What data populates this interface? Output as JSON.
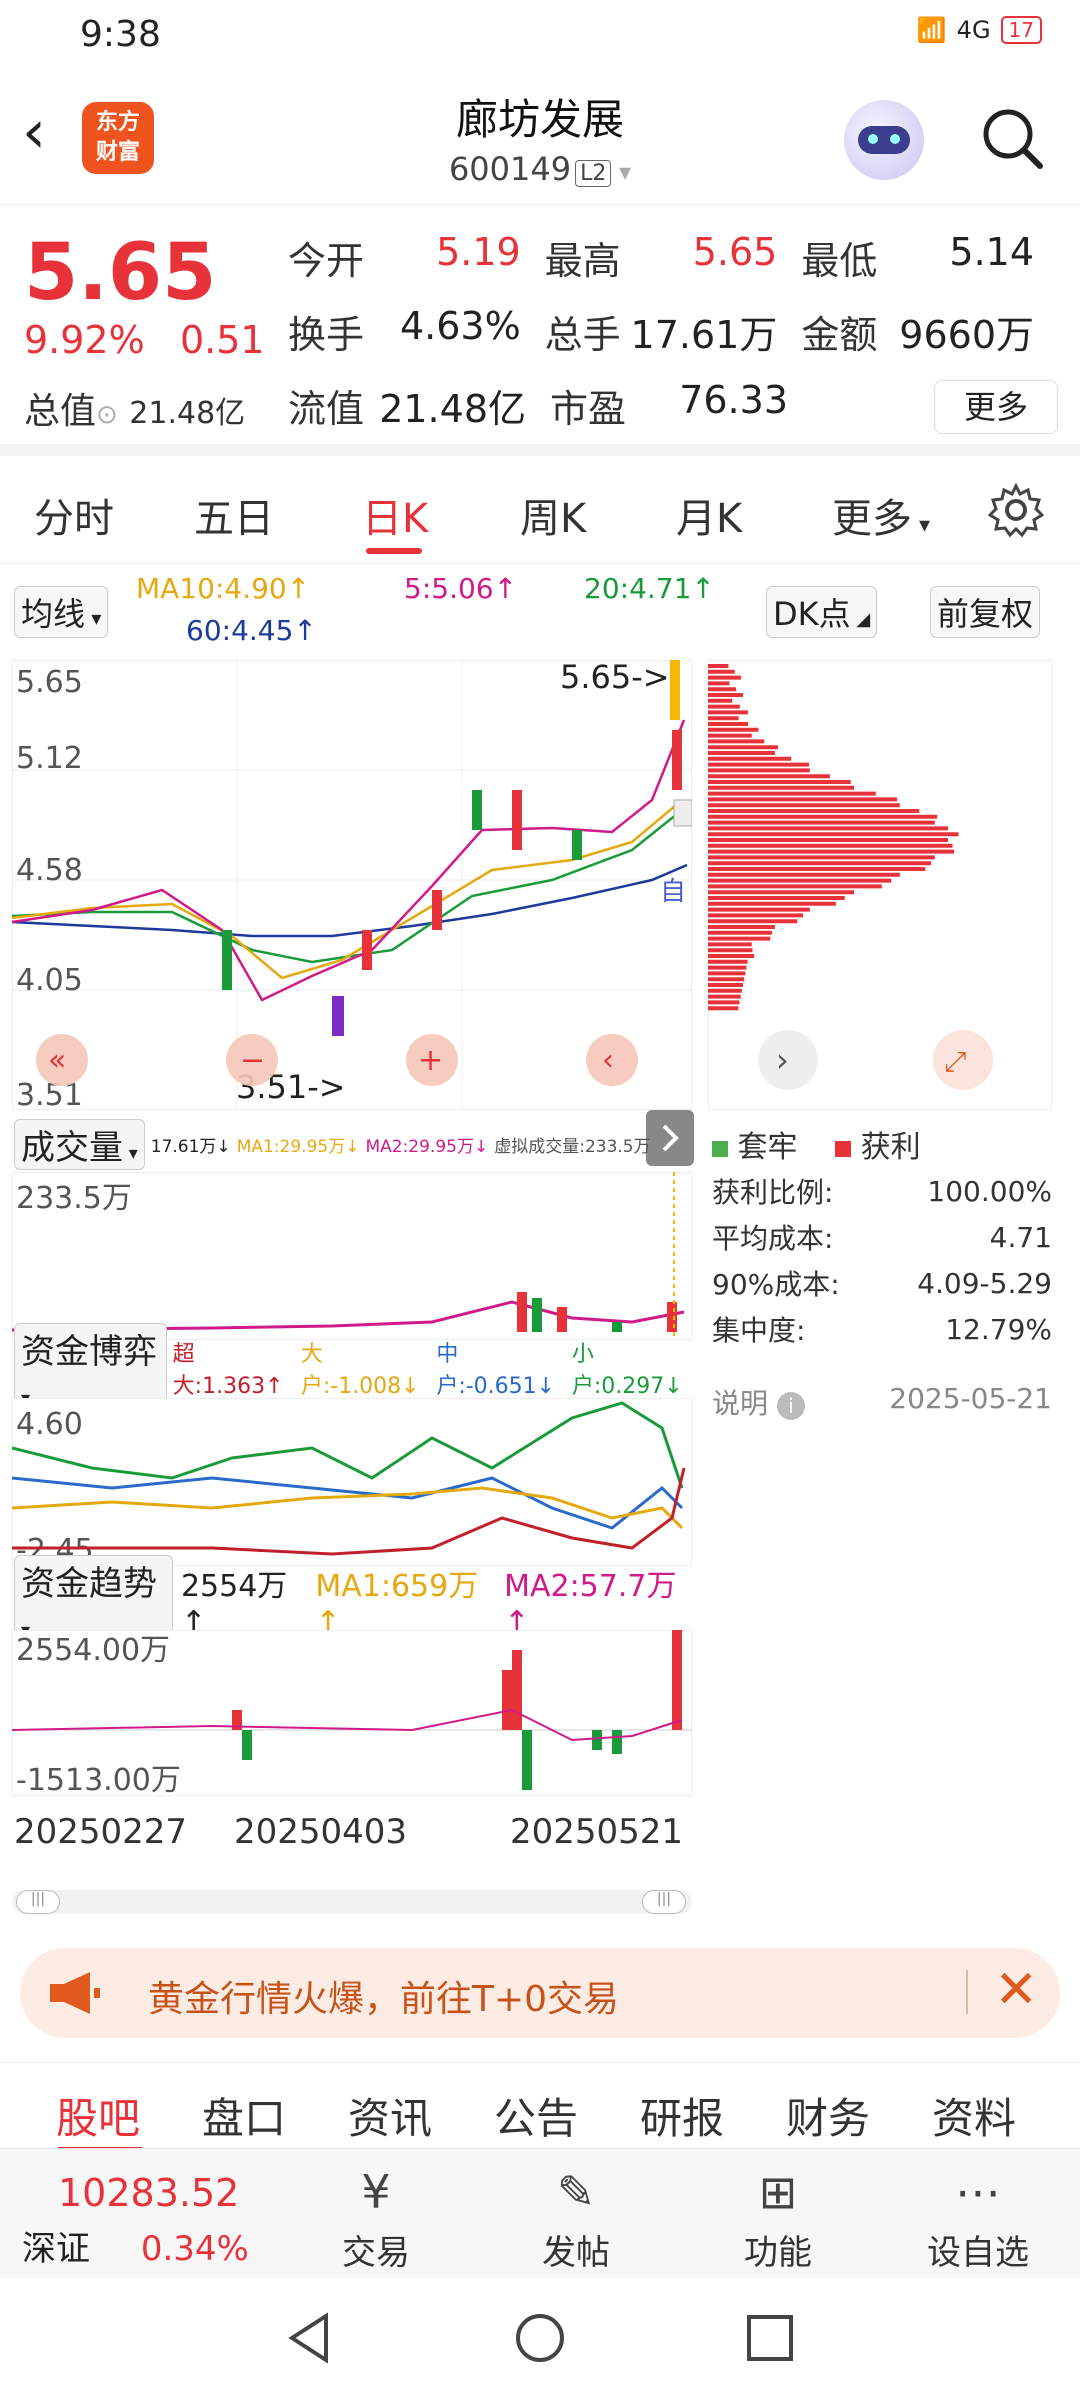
{
  "status": {
    "time": "9:38",
    "network": "4G",
    "battery": "17"
  },
  "header": {
    "title": "廊坊发展",
    "code": "600149",
    "level": "L2",
    "logo_line1": "东方",
    "logo_line2": "财富"
  },
  "quote": {
    "price": "5.65",
    "pct": "9.92%",
    "change": "0.51",
    "total_value_label": "总值",
    "total_value": "21.48亿",
    "rows": [
      [
        {
          "label": "今开",
          "value": "5.19",
          "color": "red"
        },
        {
          "label": "最高",
          "value": "5.65",
          "color": "red"
        },
        {
          "label": "最低",
          "value": "5.14",
          "color": "normal"
        }
      ],
      [
        {
          "label": "换手",
          "value": "4.63%",
          "color": "normal"
        },
        {
          "label": "总手",
          "value": "17.61万",
          "color": "normal"
        },
        {
          "label": "金额",
          "value": "9660万",
          "color": "normal"
        }
      ],
      [
        {
          "label": "流值",
          "value": "21.48亿",
          "color": "normal"
        },
        {
          "label": "市盈",
          "value": "76.33",
          "color": "normal"
        }
      ]
    ],
    "more": "更多"
  },
  "tabs": [
    "分时",
    "五日",
    "日K",
    "周K",
    "月K",
    "更多"
  ],
  "active_tab": "日K",
  "ma": {
    "selector": "均线",
    "ma10": "MA10:4.90↑",
    "ma5": "5:5.06↑",
    "ma20": "20:4.71↑",
    "ma60": "60:4.45↑",
    "dk": "DK点",
    "fq": "前复权"
  },
  "kchart": {
    "y_labels": [
      "5.65",
      "5.12",
      "4.58",
      "4.05",
      "3.51"
    ],
    "high_marker": "5.65->",
    "low_marker": "3.51->",
    "self_tag": "自"
  },
  "volume": {
    "selector": "成交量",
    "info": "17.61万↓",
    "ma1": "MA1:29.95万↓",
    "ma2": "MA2:29.95万↓",
    "virtual": "虚拟成交量:233.5万",
    "max_label": "233.5万"
  },
  "fund_game": {
    "selector": "资金博弈",
    "super": "超大:1.363↑",
    "large": "大户:-1.008↓",
    "mid": "中户:-0.651↓",
    "small": "小户:0.297↓",
    "top": "4.60",
    "bottom": "-2.45"
  },
  "fund_trend": {
    "selector": "资金趋势",
    "value": "2554万↑",
    "ma1": "MA1:659万↑",
    "ma2": "MA2:57.7万↑",
    "top": "2554.00万",
    "bottom": "-1513.00万"
  },
  "dates": [
    "20250227",
    "20250403",
    "20250521"
  ],
  "cost": {
    "legend_trapped": "套牢",
    "legend_profit": "获利",
    "rows": [
      {
        "label": "获利比例:",
        "value": "100.00%"
      },
      {
        "label": "平均成本:",
        "value": "4.71"
      },
      {
        "label": "90%成本:",
        "value": "4.09-5.29"
      },
      {
        "label": "集中度:",
        "value": "12.79%"
      }
    ],
    "note": "说明",
    "date": "2025-05-21"
  },
  "banner": {
    "text": "黄金行情火爆，前往T+0交易"
  },
  "content_tabs": [
    "股吧",
    "盘口",
    "资讯",
    "公告",
    "研报",
    "财务",
    "资料"
  ],
  "bottom": {
    "index_value": "10283.52",
    "index_name": "深证",
    "index_pct": "0.34%",
    "items": [
      "交易",
      "发帖",
      "功能",
      "设自选"
    ]
  },
  "colors": {
    "up": "#e8323a",
    "down": "#1a9b3a",
    "accent": "#f0541e"
  }
}
